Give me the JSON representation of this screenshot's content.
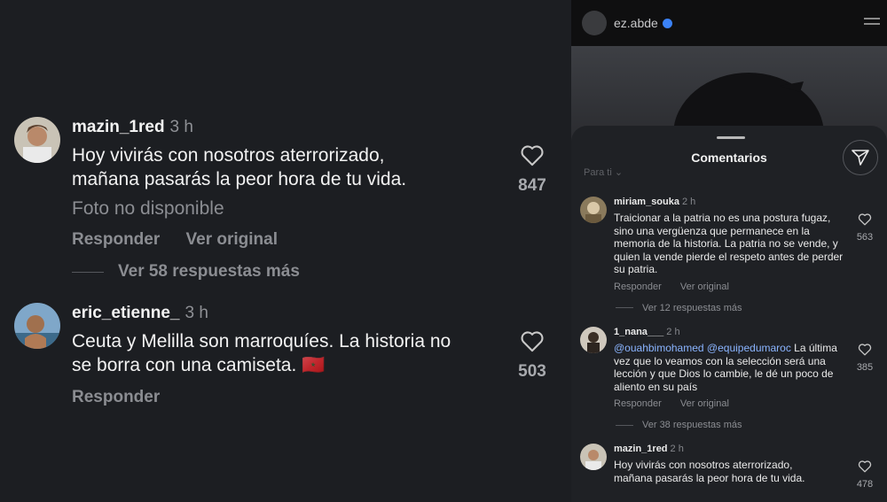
{
  "left": {
    "comments": [
      {
        "username": "mazin_1red",
        "time": "3 h",
        "text_line1": "Hoy vivirás con nosotros aterrorizado,",
        "text_line2": "mañana pasarás la peor hora de tu vida.",
        "unavailable": "Foto no disponible",
        "reply": "Responder",
        "original": "Ver original",
        "more_replies": "Ver 58 respuestas más",
        "likes": "847"
      },
      {
        "username": "eric_etienne_",
        "time": "3 h",
        "text_line1": "Ceuta y Melilla son marroquíes. La historia no",
        "text_line2": "se borra con una camiseta. 🇲🇦",
        "reply": "Responder",
        "likes": "503"
      }
    ]
  },
  "right": {
    "account": "ez.abde",
    "sheet_title": "Comentarios",
    "filter": "Para ti",
    "comments": [
      {
        "username": "miriam_souka",
        "time": "2 h",
        "text": "Traicionar a la patria no es una postura fugaz, sino una vergüenza que permanece en la memoria de la historia. La patria no se vende, y quien la vende pierde el respeto antes de perder su patria.",
        "reply": "Responder",
        "original": "Ver original",
        "more_replies": "Ver 12 respuestas más",
        "likes": "563"
      },
      {
        "username": "1_nana___",
        "time": "2 h",
        "mention1": "@ouahbimohamed",
        "mention2": "@equipedumaroc",
        "text": "La última vez que lo veamos con la selección será una lección y que Dios lo cambie, le dé un poco de aliento en su país",
        "reply": "Responder",
        "original": "Ver original",
        "more_replies": "Ver 38 respuestas más",
        "likes": "385"
      },
      {
        "username": "mazin_1red",
        "time": "2 h",
        "text_line1": "Hoy vivirás con nosotros aterrorizado,",
        "text_line2": "mañana pasarás la peor hora de tu vida.",
        "likes": "478"
      }
    ]
  },
  "colors": {
    "left_bg": "#1c1e22",
    "right_bg": "#0f0f10",
    "sheet_bg": "#1f2125",
    "text": "#f2f2f2",
    "muted": "#8b8d92",
    "mention": "#8ab4ff",
    "verified": "#3b82f6"
  },
  "icons": {
    "like": "heart-icon",
    "share": "send-icon",
    "menu": "hamburger-icon",
    "verified": "verified-badge-icon"
  }
}
